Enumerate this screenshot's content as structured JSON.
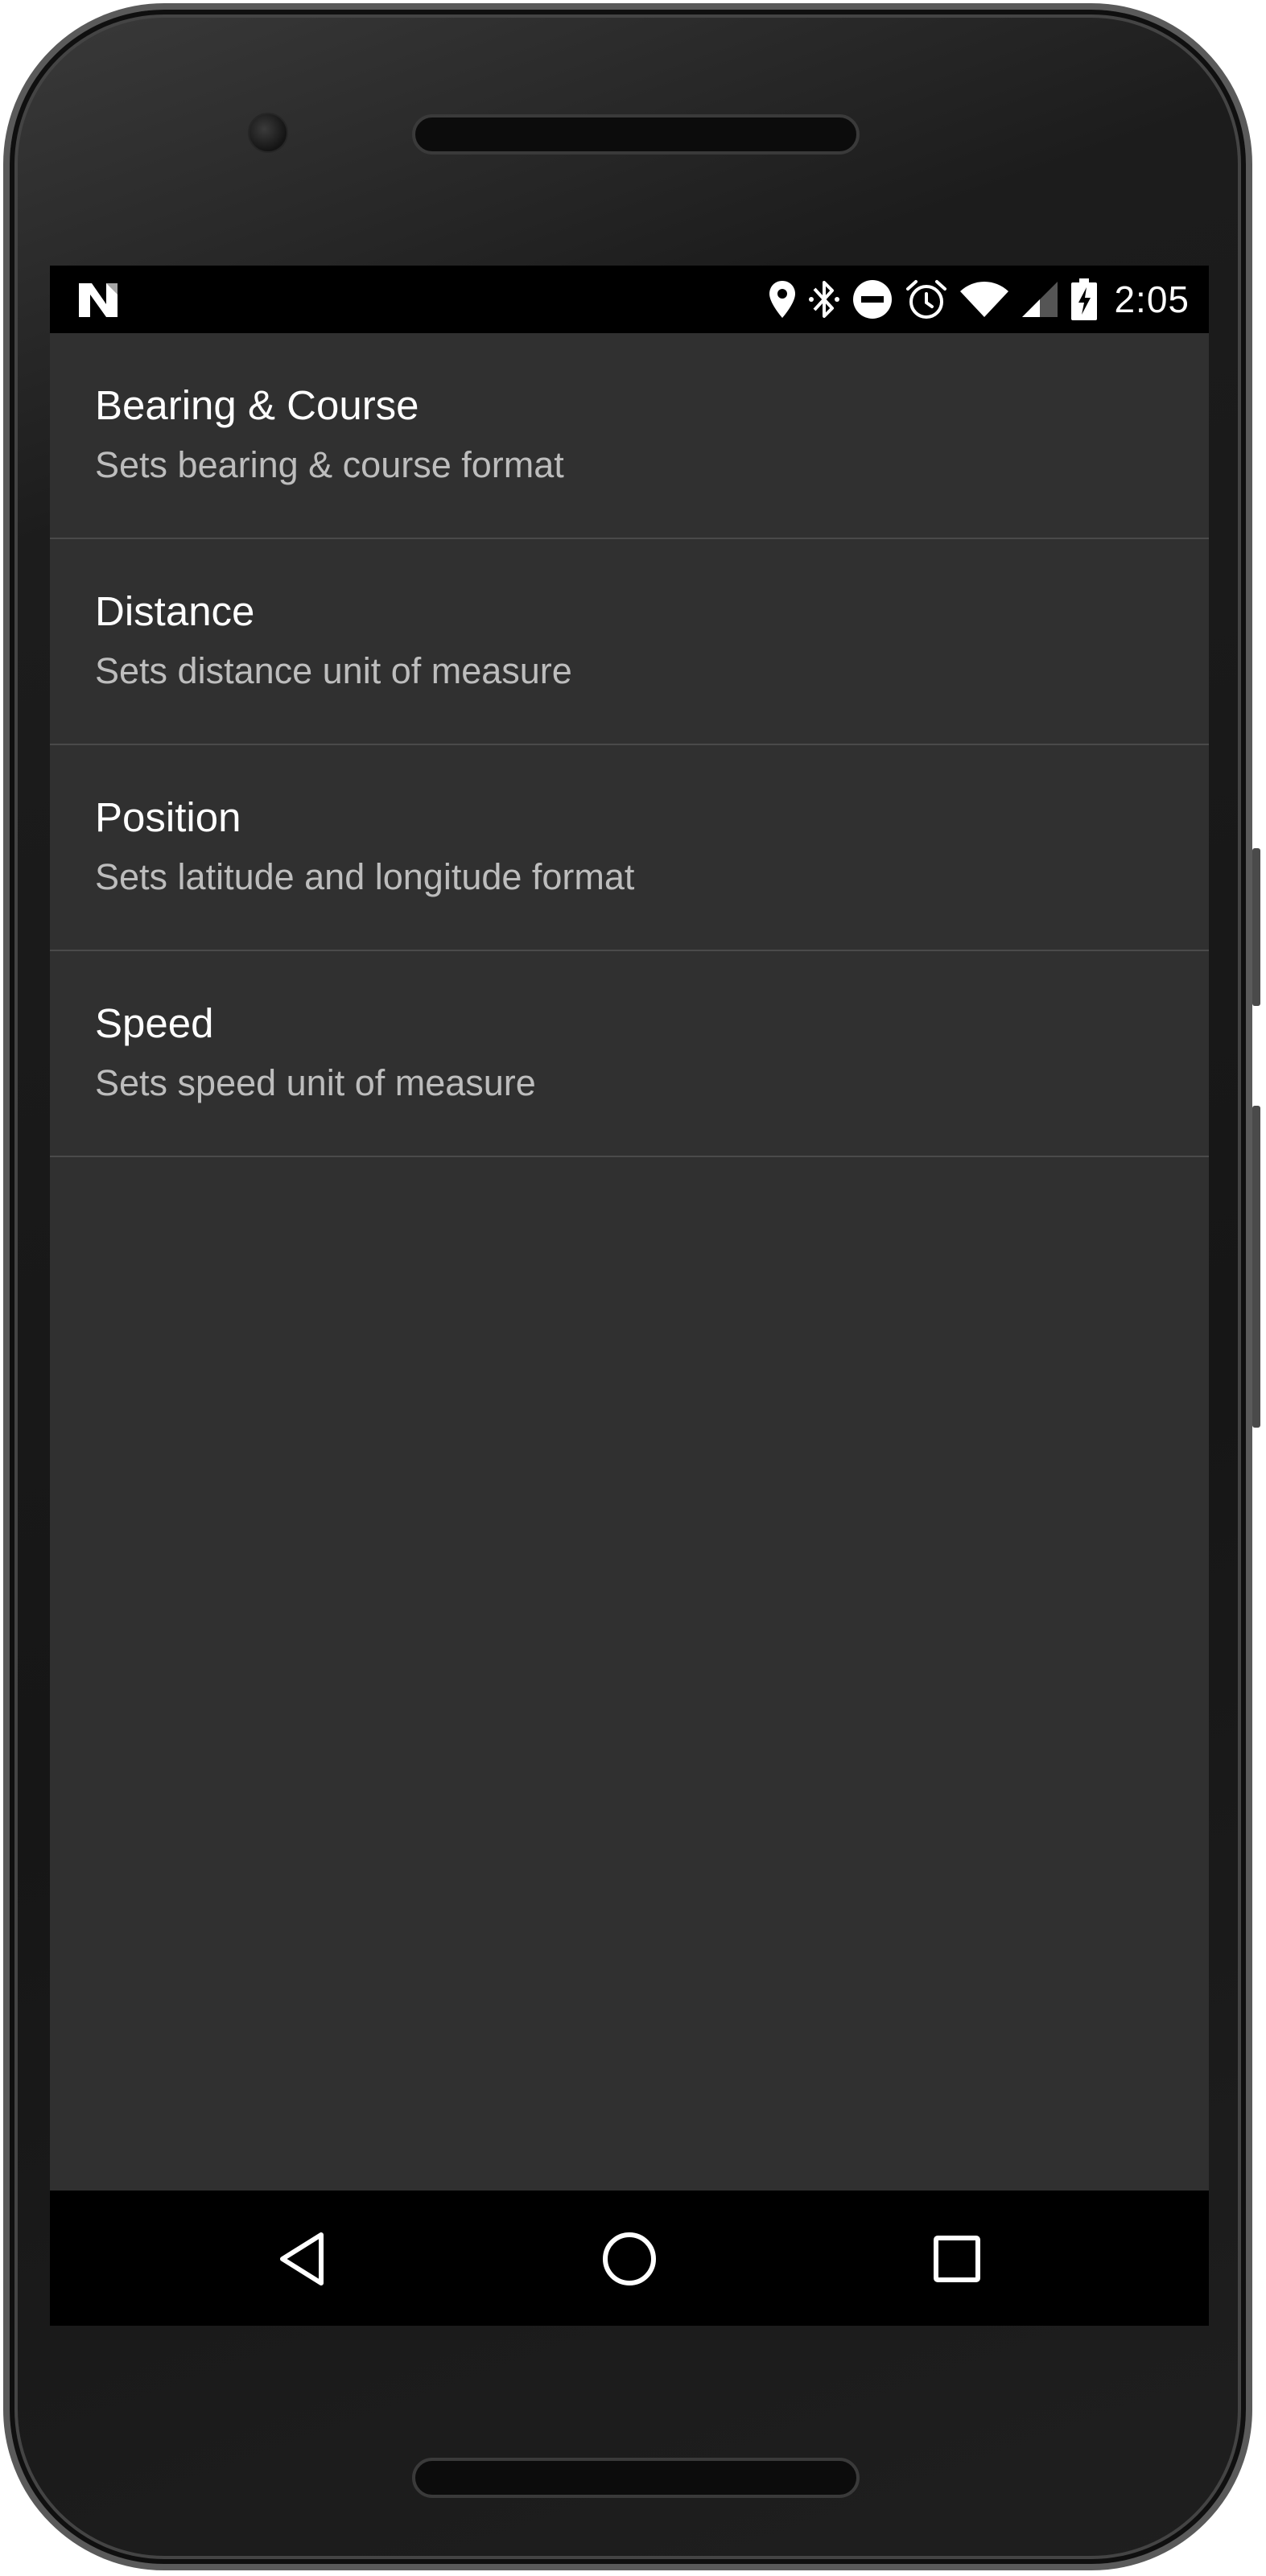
{
  "status_bar": {
    "notification_icon": "n-logo-icon",
    "icons": [
      "location-icon",
      "bluetooth-icon",
      "do-not-disturb-icon",
      "alarm-icon",
      "wifi-icon",
      "cell-signal-icon",
      "battery-charging-icon"
    ],
    "time": "2:05"
  },
  "settings": {
    "items": [
      {
        "title": "Bearing & Course",
        "summary": "Sets bearing & course format"
      },
      {
        "title": "Distance",
        "summary": "Sets distance unit of measure"
      },
      {
        "title": "Position",
        "summary": "Sets latitude and longitude format"
      },
      {
        "title": "Speed",
        "summary": "Sets speed unit of measure"
      }
    ]
  },
  "nav_bar": {
    "buttons": [
      "back-icon",
      "home-icon",
      "recents-icon"
    ]
  },
  "colors": {
    "screen_background": "#303030",
    "bar_background": "#000000",
    "title_text": "#ffffff",
    "summary_text": "#bdbdbd",
    "divider": "#4a4a4a"
  }
}
